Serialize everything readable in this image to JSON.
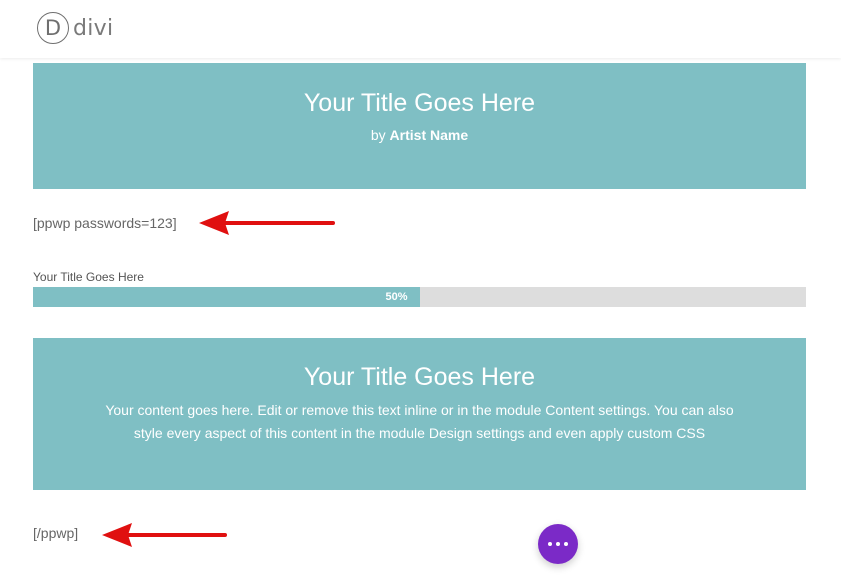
{
  "header": {
    "logo_mark": "D",
    "logo_text": "divi"
  },
  "hero_1": {
    "title": "Your Title Goes Here",
    "by_prefix": "by",
    "artist": "Artist Name"
  },
  "shortcode_open": "[ppwp passwords=123]",
  "progress": {
    "label": "Your Title Goes Here",
    "percent_text": "50%",
    "value": 0.5
  },
  "hero_2": {
    "title": "Your Title Goes Here",
    "body": "Your content goes here. Edit or remove this text inline or in the module Content settings. You can also style every aspect of this content in the module Design settings and even apply custom CSS"
  },
  "shortcode_close": "[/ppwp]",
  "fab": {
    "icon": "more-horizontal-icon"
  },
  "colors": {
    "accent_teal": "#7fbfc4",
    "fab_purple": "#7b2ac7",
    "arrow_red": "#e01010",
    "bar_track": "#dddddd"
  }
}
